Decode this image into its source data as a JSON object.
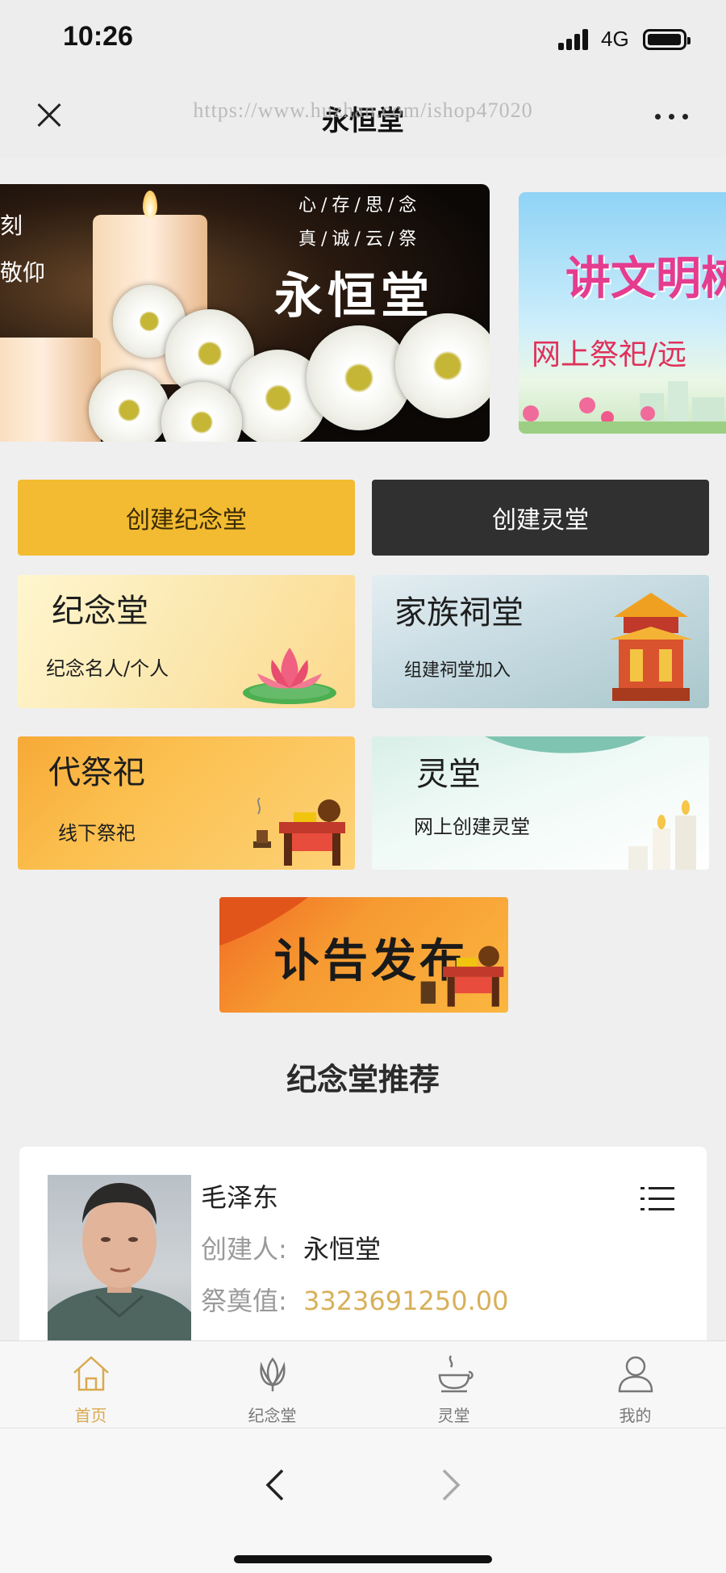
{
  "status_bar": {
    "time": "10:26",
    "network": "4G"
  },
  "nav": {
    "title": "永恒堂",
    "watermark": "https://www.huzhan.com/ishop47020"
  },
  "banner": {
    "main": {
      "line1": "心/存/思/念",
      "line2": "真/诚/云/祭",
      "title": "永恒堂",
      "left_line1": "时刻",
      "left_line2": "敬仰"
    },
    "side": {
      "title": "讲文明树",
      "subtitle": "网上祭祀/远"
    }
  },
  "actions": {
    "create_memorial": "创建纪念堂",
    "create_spirit_hall": "创建灵堂"
  },
  "tiles": {
    "memorial": {
      "title": "纪念堂",
      "subtitle": "纪念名人/个人"
    },
    "clan": {
      "title": "家族祠堂",
      "subtitle": "组建祠堂加入"
    },
    "proxy": {
      "title": "代祭祀",
      "subtitle": "线下祭祀"
    },
    "spirit": {
      "title": "灵堂",
      "subtitle": "网上创建灵堂"
    },
    "obituary": {
      "title": "讣告发布"
    }
  },
  "section": {
    "recommend_title": "纪念堂推荐"
  },
  "card": {
    "name": "毛泽东",
    "creator_label": "创建人:",
    "creator_value": "永恒堂",
    "offering_label": "祭奠值:",
    "offering_value": "3323691250.00"
  },
  "tab_bar": {
    "items": [
      {
        "label": "首页",
        "icon": "home-icon",
        "active": true
      },
      {
        "label": "纪念堂",
        "icon": "lotus-icon",
        "active": false
      },
      {
        "label": "灵堂",
        "icon": "incense-icon",
        "active": false
      },
      {
        "label": "我的",
        "icon": "user-icon",
        "active": false
      }
    ]
  },
  "colors": {
    "accent_gold": "#f2bb31",
    "active_tab": "#d9a94f",
    "dark_button": "#303030",
    "amount": "#d8b05a"
  }
}
